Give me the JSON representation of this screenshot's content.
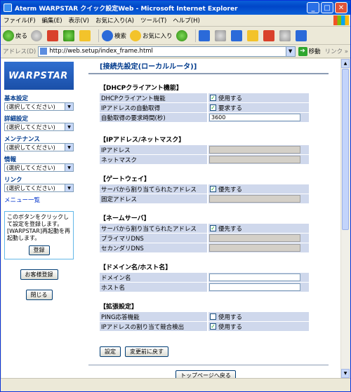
{
  "window": {
    "title": "Aterm WARPSTAR クイック設定Web - Microsoft Internet Explorer"
  },
  "menu": [
    "ファイル(F)",
    "編集(E)",
    "表示(V)",
    "お気に入り(A)",
    "ツール(T)",
    "ヘルプ(H)"
  ],
  "toolbar": {
    "back": "戻る",
    "search": "検索",
    "favorites": "お気に入り"
  },
  "address": {
    "label": "アドレス(D)",
    "url": "http://web.setup/index_frame.html",
    "go": "移動",
    "links": "リンク »"
  },
  "sidebar": {
    "logo": "WARPSTAR",
    "groups": [
      {
        "label": "基本設定",
        "selected": "(選択してください)"
      },
      {
        "label": "詳細設定",
        "selected": "(選択してください)"
      },
      {
        "label": "メンテナンス",
        "selected": "(選択してください)"
      },
      {
        "label": "情報",
        "selected": "(選択してください)"
      },
      {
        "label": "リンク",
        "selected": "(選択してください)"
      }
    ],
    "menu_list": "メニュー一覧",
    "note": "このボタンをクリックして設定を登録します。[WARPSTAR]再起動を再起動します。",
    "register": "登録",
    "customer_register": "お客様登録",
    "close": "閉じる"
  },
  "page": {
    "title": "[接続先設定(ローカルルータ)]",
    "dhcp": {
      "title": "【DHCPクライアント機能】",
      "rows": [
        {
          "label": "DHCPクライアント機能",
          "check": "✓",
          "value": "使用する"
        },
        {
          "label": "IPアドレスの自動取得",
          "check": "✓",
          "value": "要求する"
        },
        {
          "label": "自動取得の要求時間(秒)",
          "input": "3600"
        }
      ]
    },
    "ipmask": {
      "title": "【IPアドレス/ネットマスク】",
      "rows": [
        {
          "label": "IPアドレス"
        },
        {
          "label": "ネットマスク"
        }
      ]
    },
    "gateway": {
      "title": "【ゲートウェイ】",
      "rows": [
        {
          "label": "サーバから割り当てられたアドレス",
          "check": "✓",
          "value": "優先する"
        },
        {
          "label": "固定アドレス"
        }
      ]
    },
    "nameserver": {
      "title": "【ネームサーバ】",
      "rows": [
        {
          "label": "サーバから割り当てられたアドレス",
          "check": "✓",
          "value": "優先する"
        },
        {
          "label": "プライマリDNS"
        },
        {
          "label": "セカンダリDNS"
        }
      ]
    },
    "domain": {
      "title": "【ドメイン名/ホスト名】",
      "rows": [
        {
          "label": "ドメイン名"
        },
        {
          "label": "ホスト名"
        }
      ]
    },
    "extended": {
      "title": "【拡張設定】",
      "rows": [
        {
          "label": "PING応答機能",
          "check": "",
          "value": "使用する"
        },
        {
          "label": "IPアドレスの割り当て競合検出",
          "check": "✓",
          "value": "使用する"
        }
      ]
    },
    "buttons": {
      "set": "設定",
      "revert": "変更前に戻す"
    },
    "top_page": "トップページへ戻る"
  }
}
